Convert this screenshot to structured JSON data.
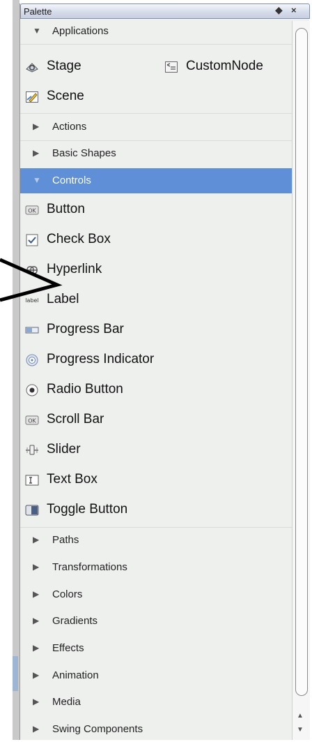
{
  "palette": {
    "title": "Palette",
    "pin_glyph": "◆",
    "close_glyph": "×"
  },
  "categories": {
    "applications": "Applications",
    "actions": "Actions",
    "basic_shapes": "Basic Shapes",
    "controls": "Controls",
    "paths": "Paths",
    "transformations": "Transformations",
    "colors": "Colors",
    "gradients": "Gradients",
    "effects": "Effects",
    "animation": "Animation",
    "media": "Media",
    "swing_components": "Swing Components"
  },
  "items": {
    "stage": "Stage",
    "custom_node": "CustomNode",
    "scene": "Scene",
    "button": "Button",
    "check_box": "Check Box",
    "hyperlink": "Hyperlink",
    "label": "Label",
    "progress_bar": "Progress Bar",
    "progress_indicator": "Progress Indicator",
    "radio_button": "Radio Button",
    "scroll_bar": "Scroll Bar",
    "slider": "Slider",
    "text_box": "Text Box",
    "toggle_button": "Toggle Button"
  },
  "icon_text": {
    "ok": "OK",
    "label": "label"
  },
  "colors": {
    "selection": "#5f8fd6",
    "panel": "#eef0ee"
  },
  "expanded_category": "Controls"
}
